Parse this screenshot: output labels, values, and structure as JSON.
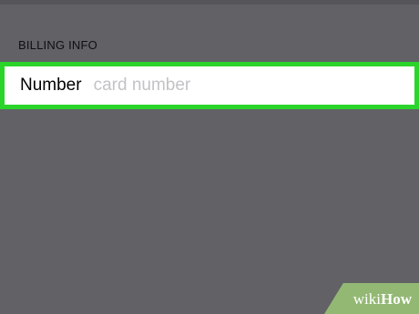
{
  "billing": {
    "section_title": "BILLING INFO",
    "card_number_label": "Number",
    "card_number_placeholder": "card number",
    "card_number_value": ""
  },
  "watermark": {
    "text_light": "wiki",
    "text_bold": "How"
  },
  "colors": {
    "background": "#616166",
    "highlight_border": "#2bd42b",
    "watermark_tab": "#93b874"
  }
}
